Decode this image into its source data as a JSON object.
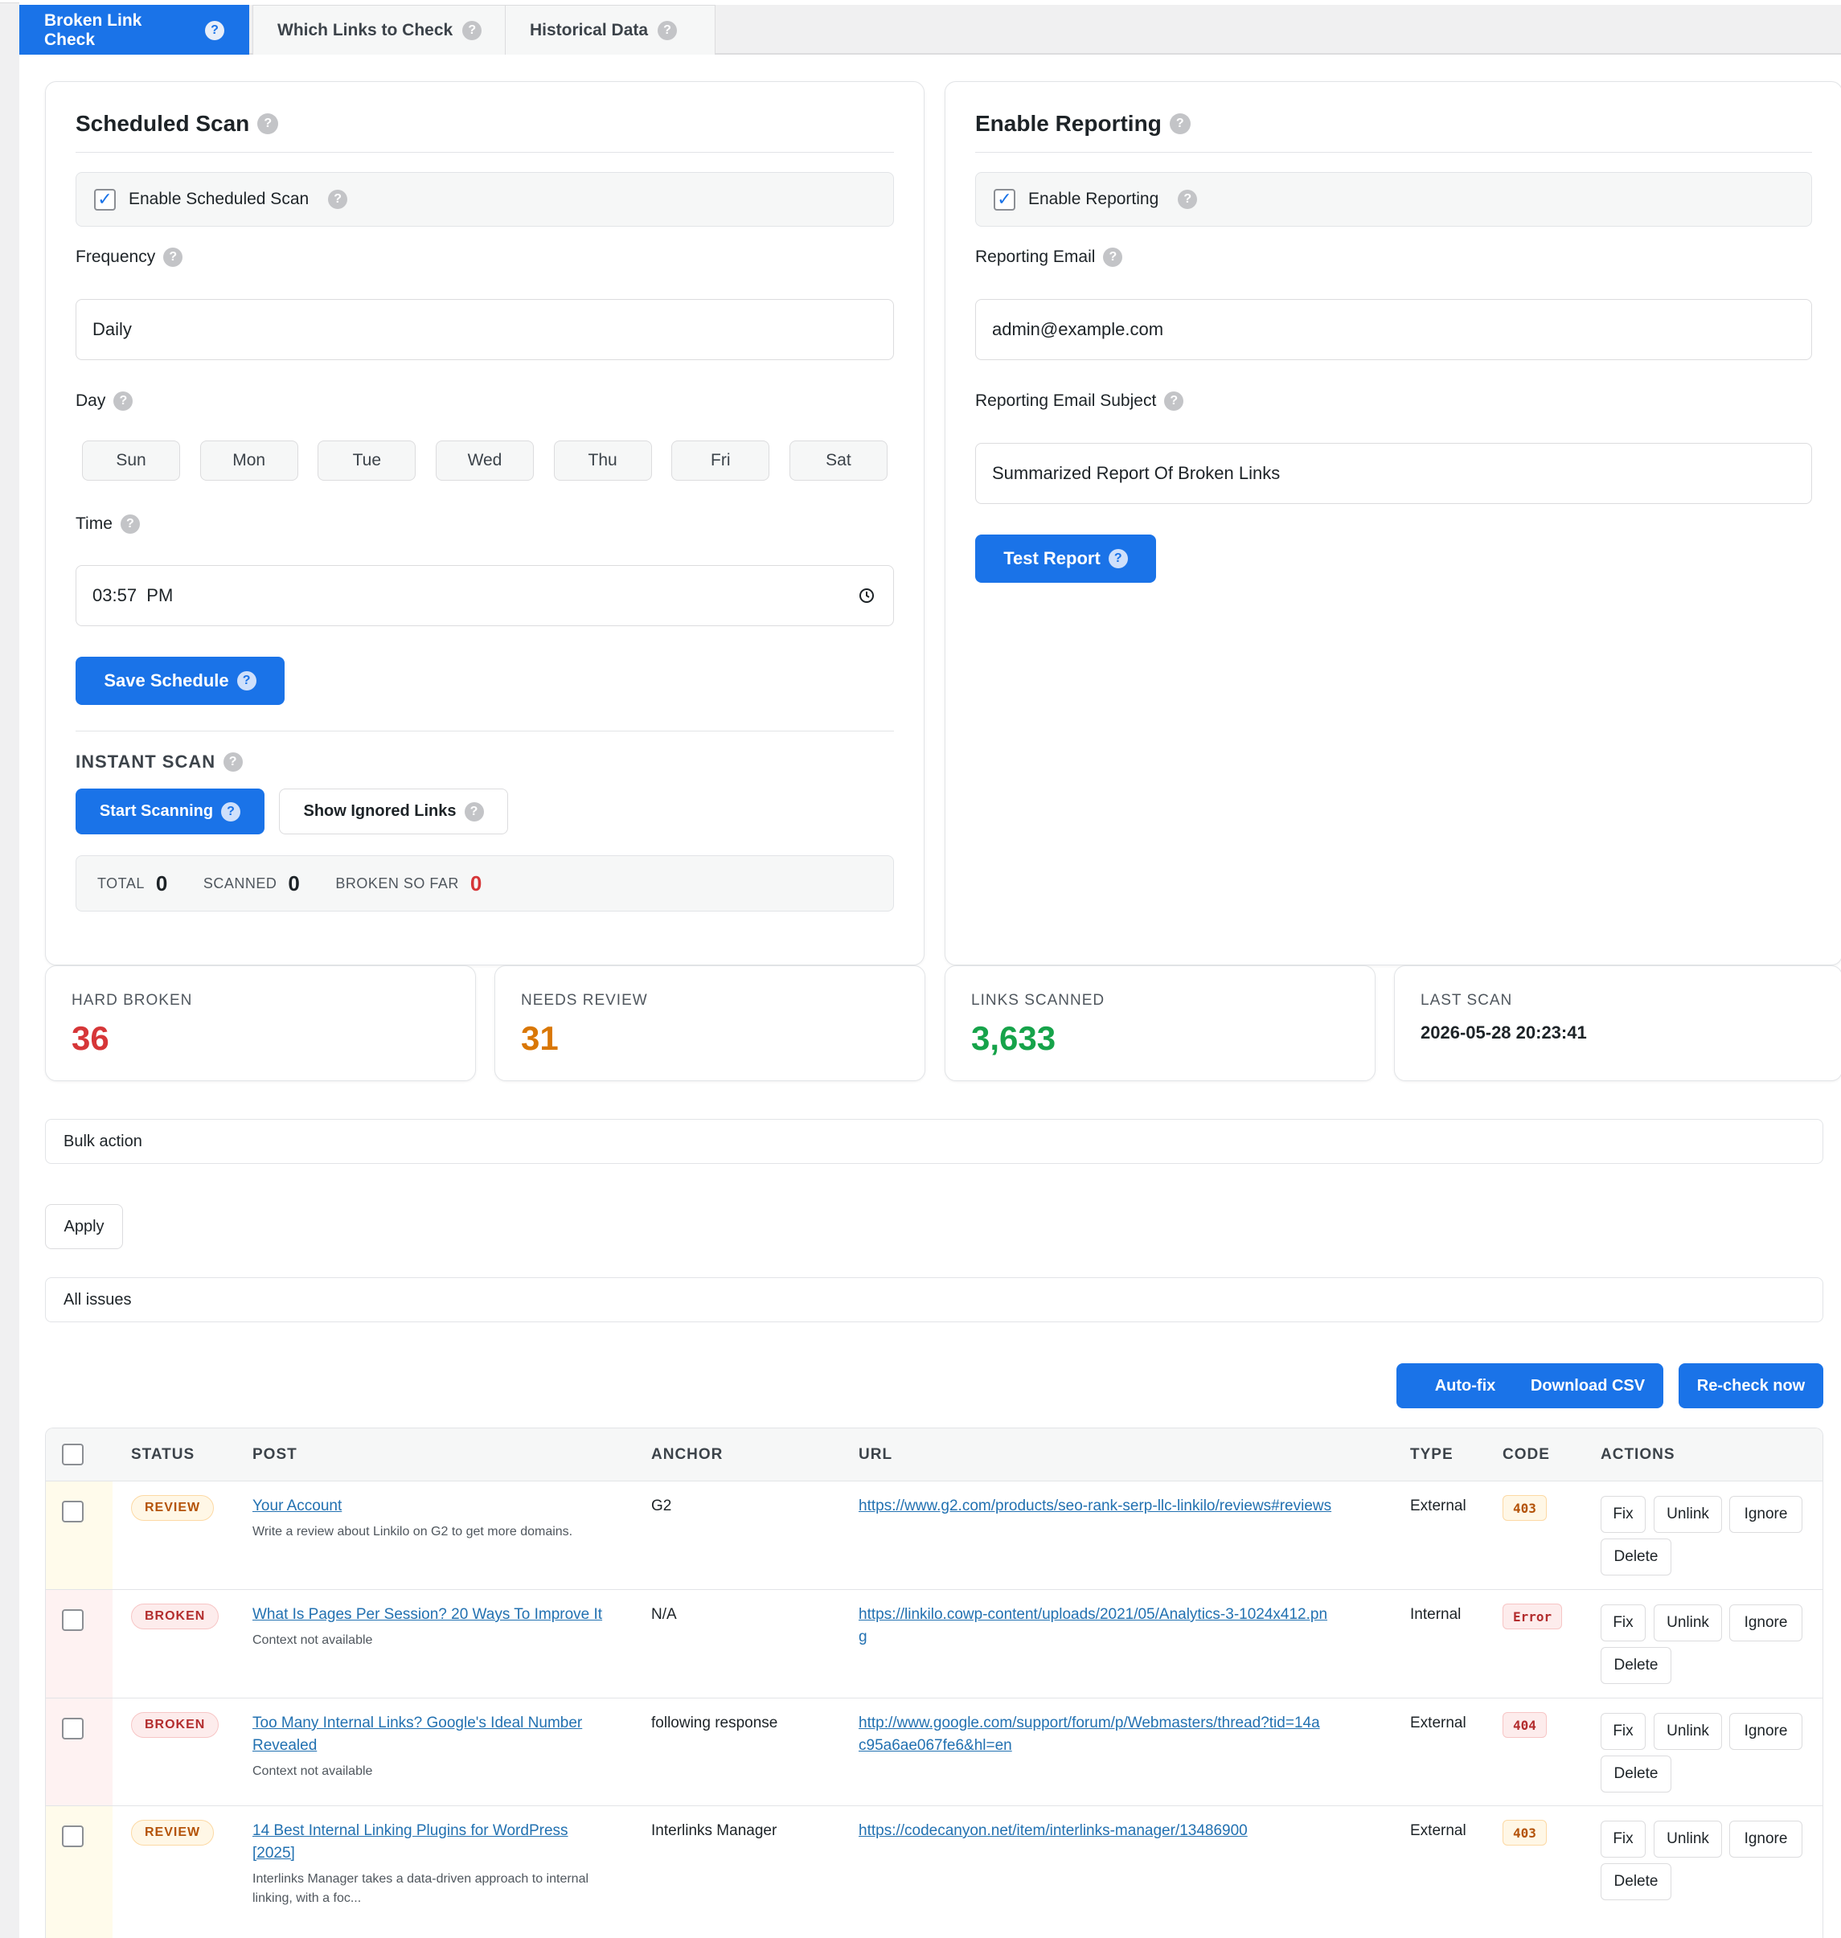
{
  "tabs": [
    {
      "label": "Broken Link Check"
    },
    {
      "label": "Which Links to Check"
    },
    {
      "label": "Historical Data"
    }
  ],
  "scheduled_scan": {
    "title": "Scheduled Scan",
    "enable_label": "Enable Scheduled Scan",
    "frequency_label": "Frequency",
    "frequency_value": "Daily",
    "day_label": "Day",
    "days": [
      "Sun",
      "Mon",
      "Tue",
      "Wed",
      "Thu",
      "Fri",
      "Sat"
    ],
    "time_label": "Time",
    "time_value": "03:57  PM",
    "save_button": "Save Schedule",
    "instant_scan_label": "INSTANT SCAN",
    "start_button": "Start Scanning",
    "show_ignored_button": "Show Ignored Links",
    "counts": {
      "total_label": "TOTAL",
      "total_value": "0",
      "scanned_label": "SCANNED",
      "scanned_value": "0",
      "broken_label": "BROKEN SO FAR",
      "broken_value": "0"
    }
  },
  "reporting": {
    "title": "Enable Reporting",
    "enable_label": "Enable Reporting",
    "email_label": "Reporting Email",
    "email_value": "admin@example.com",
    "subject_label": "Reporting Email Subject",
    "subject_value": "Summarized Report Of Broken Links",
    "test_button": "Test Report"
  },
  "stats": [
    {
      "label": "HARD BROKEN",
      "value": "36",
      "color": "#d63638"
    },
    {
      "label": "NEEDS REVIEW",
      "value": "31",
      "color": "#d97706"
    },
    {
      "label": "LINKS SCANNED",
      "value": "3,633",
      "color": "#16a34a"
    },
    {
      "label": "LAST SCAN",
      "value": "2026-05-28 20:23:41",
      "color": "#1d2327"
    }
  ],
  "bulk": {
    "bulk_action": "Bulk action",
    "apply": "Apply",
    "filter": "All issues"
  },
  "toolbar": {
    "autofix": "Auto-fix",
    "download": "Download CSV",
    "recheck": "Re-check now"
  },
  "table": {
    "headers": [
      "STATUS",
      "POST",
      "ANCHOR",
      "URL",
      "TYPE",
      "CODE",
      "ACTIONS"
    ],
    "actions": [
      "Fix",
      "Unlink",
      "Ignore",
      "Delete"
    ],
    "rows": [
      {
        "status": "REVIEW",
        "post_line1": "Your Account",
        "post_line2": "",
        "post_desc1": "Write a review about Linkilo on G2 to get more domains.",
        "post_desc2": "",
        "anchor": "G2",
        "url_line1": "https://www.g2.com/products/seo-rank-serp-llc-linkilo/reviews#reviews",
        "url_line2": "",
        "type": "External",
        "code": "403"
      },
      {
        "status": "BROKEN",
        "post_line1": "What Is Pages Per Session? 20 Ways To Improve It",
        "post_line2": "",
        "post_desc1": "Context not available",
        "post_desc2": "",
        "anchor": "N/A",
        "url_line1": "https://linkilo.cowp-content/uploads/2021/05/Analytics-3-1024x412.pn",
        "url_line2": "g",
        "type": "Internal",
        "code": "Error"
      },
      {
        "status": "BROKEN",
        "post_line1": "Too Many Internal Links? Google's Ideal Number",
        "post_line2": "Revealed",
        "post_desc1": "Context not available",
        "post_desc2": "",
        "anchor": "following response",
        "url_line1": "http://www.google.com/support/forum/p/Webmasters/thread?tid=14a",
        "url_line2": "c95a6ae067fe6&hl=en",
        "type": "External",
        "code": "404"
      },
      {
        "status": "REVIEW",
        "post_line1": "14 Best Internal Linking Plugins for WordPress",
        "post_line2": "[2025]",
        "post_desc1": "Interlinks Manager takes a data-driven approach to internal",
        "post_desc2": "linking, with a foc...",
        "anchor": "Interlinks Manager",
        "url_line1": "https://codecanyon.net/item/interlinks-manager/13486900",
        "url_line2": "",
        "type": "External",
        "code": "403"
      }
    ]
  }
}
